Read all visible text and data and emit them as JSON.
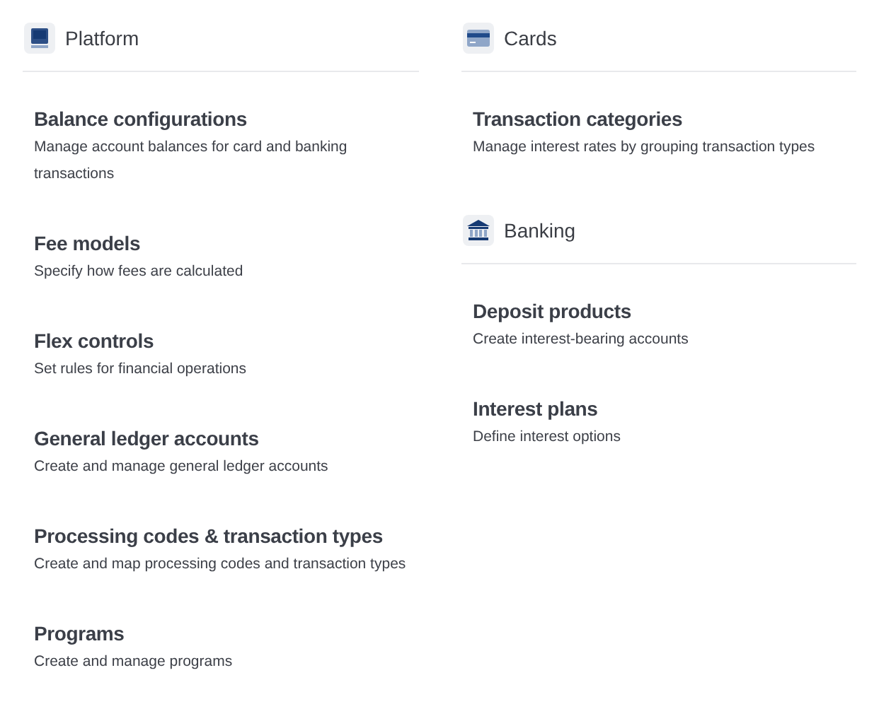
{
  "columns": [
    {
      "sections": [
        {
          "title": "Platform",
          "kind": "monitor",
          "items": [
            {
              "title": "Balance configurations",
              "description": "Manage account balances for card and banking transactions"
            },
            {
              "title": "Fee models",
              "description": "Specify how fees are calculated"
            },
            {
              "title": "Flex controls",
              "description": "Set rules for financial operations"
            },
            {
              "title": "General ledger accounts",
              "description": "Create and manage general ledger accounts"
            },
            {
              "title": "Processing codes & transaction types",
              "description": "Create and map processing codes and transaction types"
            },
            {
              "title": "Programs",
              "description": "Create and manage programs"
            }
          ]
        }
      ]
    },
    {
      "sections": [
        {
          "title": "Cards",
          "kind": "card",
          "items": [
            {
              "title": "Transaction categories",
              "description": "Manage interest rates by grouping transaction types"
            }
          ]
        },
        {
          "title": "Banking",
          "kind": "bank",
          "items": [
            {
              "title": "Deposit products",
              "description": "Create interest-bearing accounts"
            },
            {
              "title": "Interest plans",
              "description": "Define interest options"
            }
          ]
        }
      ]
    }
  ]
}
